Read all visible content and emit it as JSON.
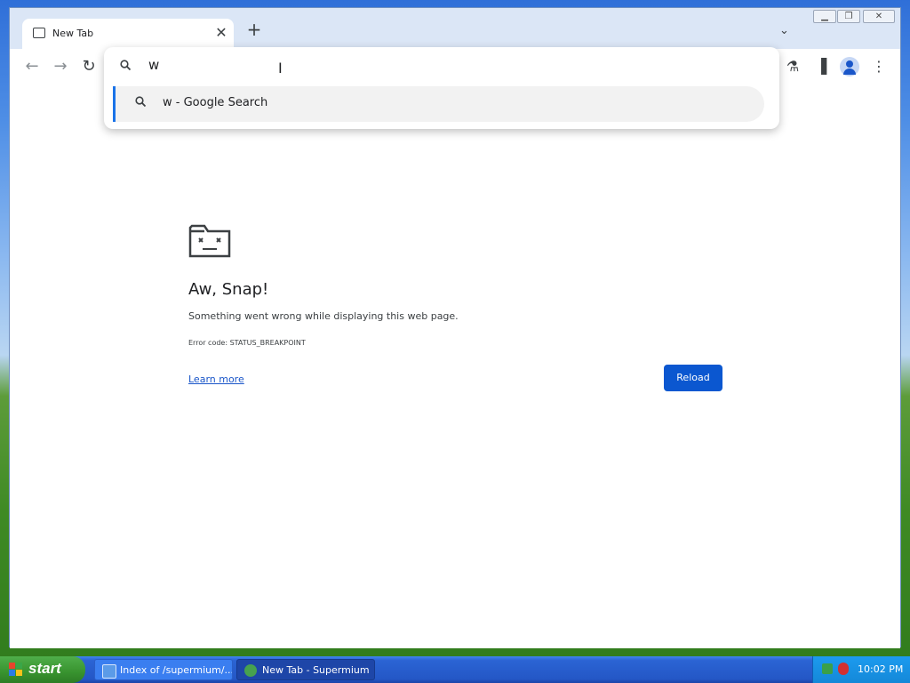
{
  "browser": {
    "tab": {
      "title": "New Tab",
      "close_glyph": "✕"
    },
    "new_tab_glyph": "+",
    "tab_search_glyph": "⌄",
    "window_buttons": {
      "minimize": "▁",
      "maximize": "❐",
      "close": "✕"
    },
    "toolbar": {
      "back": "←",
      "forward": "→",
      "reload": "↻",
      "labs": "⚗",
      "side_panel": "▐",
      "menu": "⋮"
    }
  },
  "omnibox": {
    "value": "w",
    "suggestion": {
      "text": "w - Google Search",
      "icon": "search-icon"
    }
  },
  "error_page": {
    "title": "Aw, Snap!",
    "message": "Something went wrong while displaying this web page.",
    "error_code": "Error code: STATUS_BREAKPOINT",
    "learn_more": "Learn more",
    "reload_label": "Reload"
  },
  "taskbar": {
    "start_label": "start",
    "tasks": [
      {
        "label": "Index of /supermium/..."
      },
      {
        "label": "New Tab - Supermium"
      }
    ],
    "clock": "10:02 PM"
  },
  "colors": {
    "accent": "#0b57d0",
    "link": "#1a56c9",
    "selection_bar": "#1a73e8"
  }
}
